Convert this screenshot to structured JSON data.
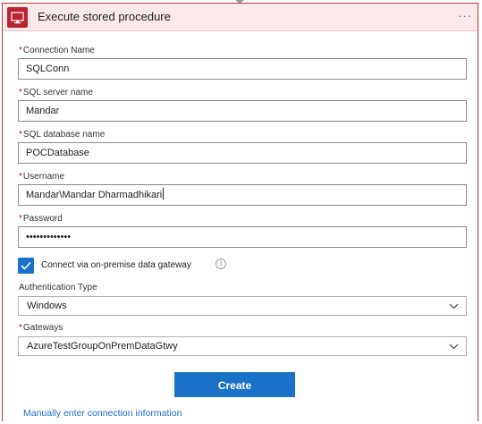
{
  "header": {
    "icon_text": "SQL",
    "title": "Execute stored procedure",
    "menu": "···"
  },
  "fields": {
    "connection_name": {
      "label": "Connection Name",
      "value": "SQLConn"
    },
    "sql_server_name": {
      "label": "SQL server name",
      "value": "Mandar"
    },
    "sql_database_name": {
      "label": "SQL database name",
      "value": "POCDatabase"
    },
    "username": {
      "label": "Username",
      "value": "Mandar\\Mandar Dharmadhikari"
    },
    "password": {
      "label": "Password",
      "value": "•••••••••••••"
    }
  },
  "required_marker": "*",
  "gateway_checkbox": {
    "checked": true,
    "label": "Connect via on-premise data gateway",
    "info_icon": "i"
  },
  "authentication_type": {
    "label": "Authentication Type",
    "selected": "Windows"
  },
  "gateways": {
    "label": "Gateways",
    "selected": "AzureTestGroupOnPremDataGtwy"
  },
  "create_button": "Create",
  "manual_link": "Manually enter connection information",
  "colors": {
    "accent": "#1a73c9",
    "header_bg": "#fbe8ea",
    "border": "#b9373c",
    "icon_bg": "#b82430",
    "required": "#d0021b",
    "link": "#1a6fc2"
  }
}
